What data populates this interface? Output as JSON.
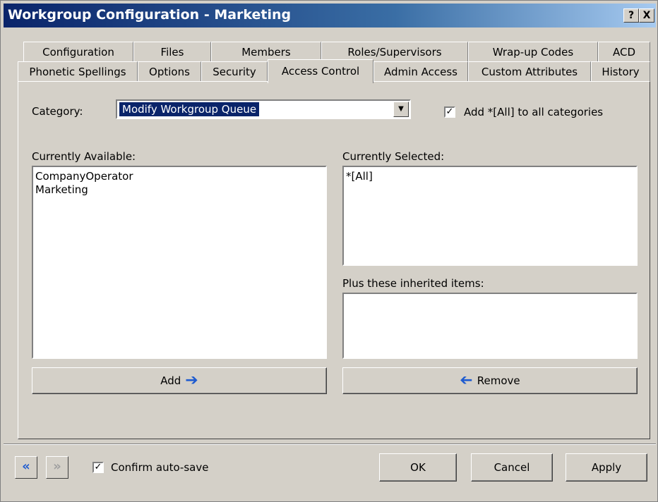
{
  "window": {
    "title": "Workgroup Configuration - Marketing",
    "help_btn": "?",
    "close_btn": "X"
  },
  "tabs": {
    "row1": [
      "Configuration",
      "Files",
      "Members",
      "Roles/Supervisors",
      "Wrap-up Codes",
      "ACD"
    ],
    "row2": [
      "Phonetic Spellings",
      "Options",
      "Security",
      "Access Control",
      "Admin Access",
      "Custom Attributes",
      "History"
    ],
    "active": "Access Control"
  },
  "category": {
    "label": "Category:",
    "selected": "Modify Workgroup Queue",
    "add_all_label": "Add *[All] to all categories",
    "add_all_checked": true
  },
  "available": {
    "label": "Currently Available:",
    "items": [
      "CompanyOperator",
      "Marketing"
    ],
    "add_button": "Add"
  },
  "selected": {
    "label": "Currently Selected:",
    "items": [
      "*[All]"
    ],
    "inherited_label": "Plus these inherited items:",
    "inherited_items": [],
    "remove_button": "Remove"
  },
  "footer": {
    "confirm_label": "Confirm auto-save",
    "confirm_checked": true,
    "ok": "OK",
    "cancel": "Cancel",
    "apply": "Apply"
  }
}
